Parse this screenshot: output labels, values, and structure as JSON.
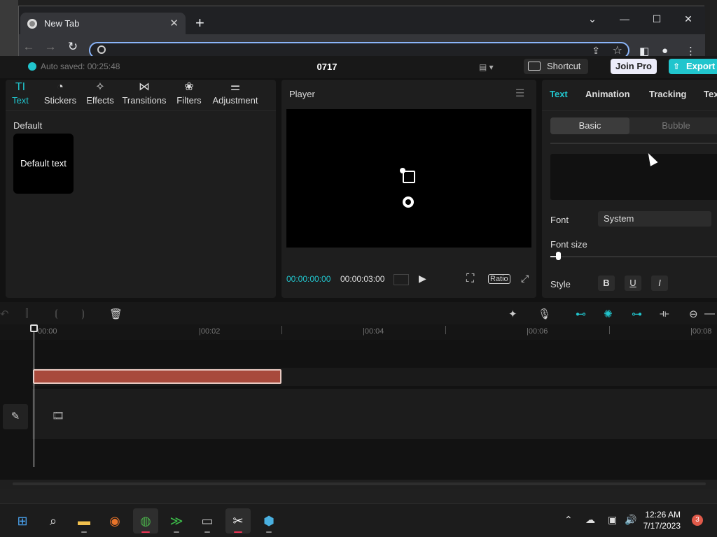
{
  "browser": {
    "tab_title": "New Tab",
    "tab_close": "✕",
    "new_tab": "+",
    "win_min": "⌄",
    "win_minimize": "—",
    "win_max": "☐",
    "win_close": "✕",
    "nav": {
      "back": "←",
      "forward": "→",
      "reload": "↻"
    },
    "omnibox_value": ""
  },
  "capcut": {
    "autosave": "Auto saved: 00:25:48",
    "project_name": "0717",
    "layout_icon": "▤ ▾",
    "shortcut_label": "Shortcut",
    "join_pro_label": "Join Pro",
    "export_label": "Export",
    "left_tabs": [
      {
        "label": "Text",
        "icon": "TI"
      },
      {
        "label": "Stickers",
        "icon": "◔"
      },
      {
        "label": "Effects",
        "icon": "✧"
      },
      {
        "label": "Transitions",
        "icon": "⋈"
      },
      {
        "label": "Filters",
        "icon": "❀"
      },
      {
        "label": "Adjustment",
        "icon": "⚌"
      }
    ],
    "default_section": "Default",
    "default_text_card": "Default text",
    "player": {
      "title": "Player",
      "time_current": "00:00:00:00",
      "time_total": "00:00:03:00",
      "ratio_label": "Ratio"
    },
    "inspector": {
      "tabs": [
        "Text",
        "Animation",
        "Tracking",
        "Tex"
      ],
      "seg_basic": "Basic",
      "seg_bubble": "Bubble",
      "font_label": "Font",
      "font_value": "System",
      "font_size_label": "Font size",
      "font_size_fraction": 0.03,
      "style_label": "Style",
      "style_bold": "B",
      "style_underline": "U",
      "style_italic": "I"
    },
    "timeline": {
      "ticks": [
        "00:00",
        "|00:02",
        "|00:04",
        "|00:06",
        "|00:08"
      ]
    }
  },
  "taskbar": {
    "time": "12:26 AM",
    "date": "7/17/2023",
    "notification_count": "3"
  },
  "colors": {
    "accent": "#21c5cd",
    "clip": "#a84a3c",
    "join_pro_bg": "#ececf9"
  }
}
